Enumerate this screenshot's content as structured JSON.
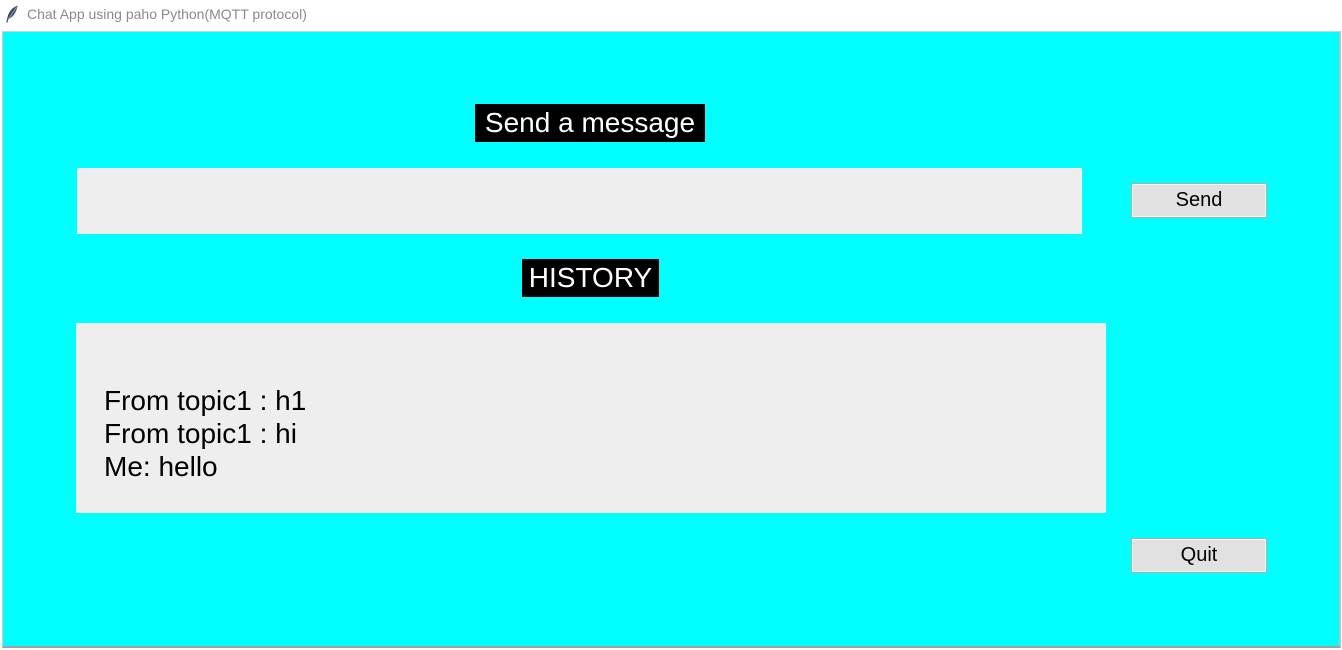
{
  "window": {
    "title": "Chat App using paho Python(MQTT protocol)",
    "icon": "feather-icon"
  },
  "send_section": {
    "heading": "Send a message",
    "input_value": "",
    "send_label": "Send"
  },
  "history_section": {
    "heading": "HISTORY",
    "messages": [
      "From topic1 : h1",
      "From topic1 : hi",
      "Me: hello"
    ]
  },
  "quit_label": "Quit",
  "colors": {
    "background": "#00ffff",
    "heading_bg": "#000000",
    "heading_text": "#ffffff",
    "field_bg": "#eeeeee",
    "button_bg": "#e1e1e1"
  }
}
